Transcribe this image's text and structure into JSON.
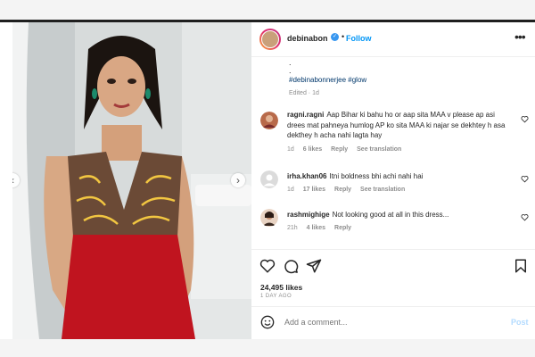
{
  "post": {
    "username": "debinabon",
    "verified_symbol": "✓",
    "separator": "•",
    "follow_label": "Follow",
    "more_icon": "more-horizontal-icon",
    "caption_dots": [
      ".",
      "."
    ],
    "hashtags": "#debinabonnerjee #glow",
    "edited": "Edited · 1d",
    "likes": "24,495 likes",
    "time_ago": "1 DAY AGO",
    "add_comment_placeholder": "Add a comment...",
    "post_label": "Post",
    "carousel_dots": 5,
    "carousel_active_index": 3,
    "accent_color": "#0095f6",
    "post_disabled_color": "#b3dbff"
  },
  "comments": [
    {
      "username": "ragni.ragni",
      "text": "Aap Bihar ki bahu ho or aap sita MAA v please ap asi drees mat pahneya humlog AP ko sita MAA ki najar se dekhtey h asa dekthey h acha nahi lagta hay",
      "time": "1d",
      "likes": "6 likes",
      "reply": "Reply",
      "translation": "See translation",
      "avatar_icon": "profile-photo-icon"
    },
    {
      "username": "irha.khan06",
      "text": "Itni boldness bhi achi nahi hai",
      "time": "1d",
      "likes": "17 likes",
      "reply": "Reply",
      "translation": "See translation",
      "avatar_icon": "default-avatar-icon"
    },
    {
      "username": "rashmighige",
      "text": "Not looking good at all in this dress...",
      "time": "21h",
      "likes": "4 likes",
      "reply": "Reply",
      "avatar_icon": "profile-photo-icon"
    }
  ],
  "icons": {
    "like": "heart-icon",
    "comment": "comment-icon",
    "share": "share-icon",
    "save": "bookmark-icon",
    "emoji": "emoji-icon",
    "prev": "chevron-left-icon",
    "next": "chevron-right-icon"
  }
}
